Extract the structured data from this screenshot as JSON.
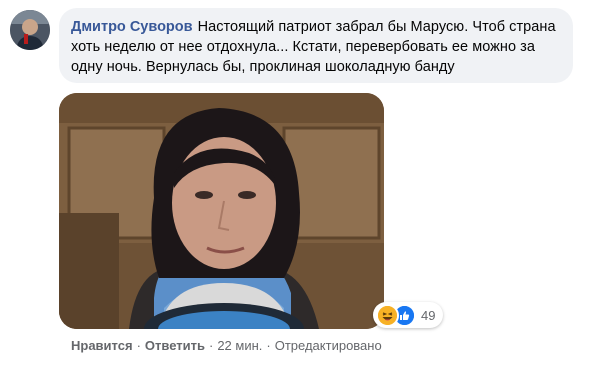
{
  "comment": {
    "author": "Дмитро Суворов",
    "text": "Настоящий патриот забрал бы Марусю. Чтоб страна хоть неделю от нее отдохнула... Кстати, перевербовать ее можно за одну ночь. Вернулась бы, проклиная шоколадную банду"
  },
  "reactions": {
    "icons": [
      "haha-icon",
      "like-icon"
    ],
    "count": "49",
    "colors": {
      "haha": "#f7b125",
      "like": "#1877f2"
    }
  },
  "actions": {
    "like_label": "Нравится",
    "reply_label": "Ответить",
    "time": "22 мин.",
    "edited": "Отредактировано",
    "separator": "·"
  }
}
